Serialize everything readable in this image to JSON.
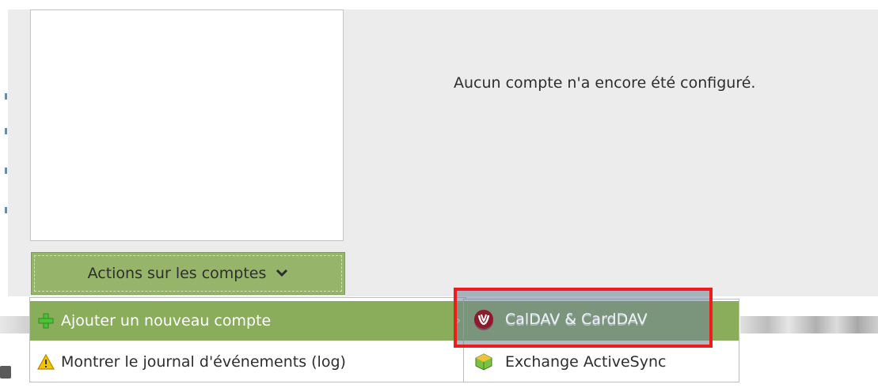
{
  "main": {
    "empty_message": "Aucun compte n'a encore été configuré."
  },
  "actions_button": {
    "label": "Actions sur les comptes",
    "chevron_icon": "chevron-down-icon"
  },
  "menu": {
    "items": [
      {
        "label": "Ajouter un nouveau compte",
        "icon": "plus-icon",
        "highlighted": true,
        "has_submenu": true
      },
      {
        "label": "Montrer le journal d'événements (log)",
        "icon": "warning-icon",
        "highlighted": false
      }
    ]
  },
  "submenu": {
    "items": [
      {
        "label": "CalDAV & CardDAV",
        "icon": "caldav-icon",
        "highlighted": true
      },
      {
        "label": "Exchange ActiveSync",
        "icon": "exchange-icon",
        "highlighted": false
      }
    ]
  },
  "colors": {
    "accent_green": "#8aad5c",
    "annotation_red": "#ee1c1c"
  }
}
